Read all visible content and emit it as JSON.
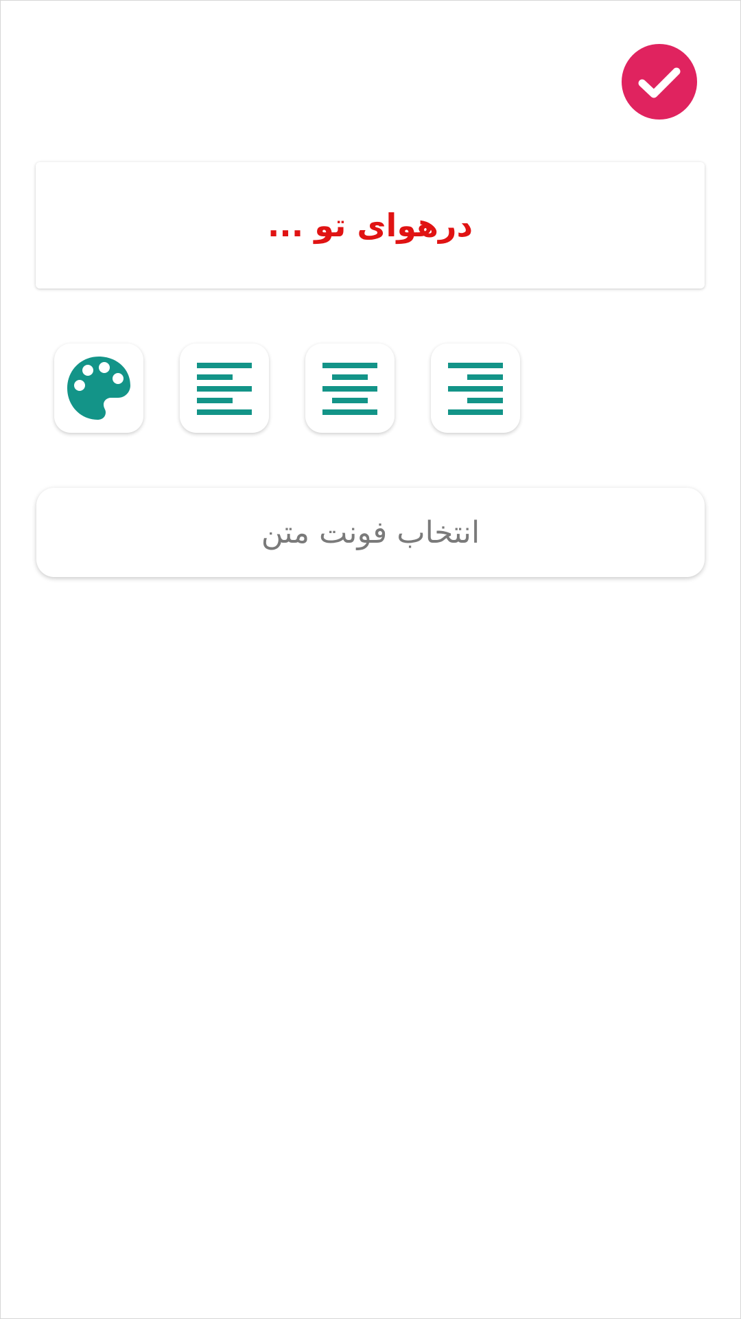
{
  "colors": {
    "confirm": "#e0235f",
    "preview_text": "#e01313",
    "icon": "#139488",
    "font_label": "#7a7a7a"
  },
  "header": {
    "confirm_icon": "check-icon"
  },
  "preview": {
    "text": "درهوای تو ..."
  },
  "toolbar": {
    "palette_icon": "palette-icon",
    "align_left_icon": "align-left-icon",
    "align_center_icon": "align-center-icon",
    "align_right_icon": "align-right-icon"
  },
  "font_selector": {
    "label": "انتخاب فونت متن"
  }
}
